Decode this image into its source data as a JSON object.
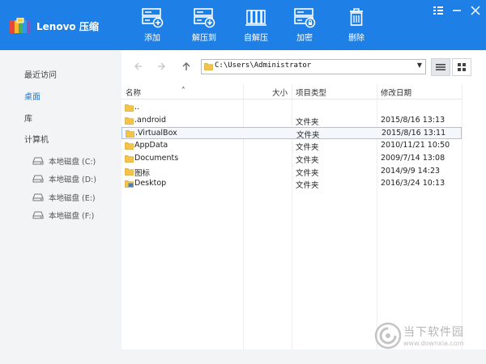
{
  "app": {
    "brand": "Lenovo 压缩"
  },
  "toolbar": [
    {
      "id": "add",
      "label": "添加"
    },
    {
      "id": "extract_to",
      "label": "解压到"
    },
    {
      "id": "self_extract",
      "label": "自解压"
    },
    {
      "id": "encrypt",
      "label": "加密"
    },
    {
      "id": "delete",
      "label": "删除"
    }
  ],
  "sidebar": {
    "items": [
      {
        "label": "最近访问",
        "active": false
      },
      {
        "label": "桌面",
        "active": true
      },
      {
        "label": "库",
        "active": false
      },
      {
        "label": "计算机",
        "active": false
      }
    ],
    "drives": [
      {
        "label": "本地磁盘 (C:)"
      },
      {
        "label": "本地磁盘 (D:)"
      },
      {
        "label": "本地磁盘 (E:)"
      },
      {
        "label": "本地磁盘 (F:)"
      }
    ]
  },
  "address": {
    "path": "C:\\Users\\Administrator"
  },
  "columns": {
    "name": "名称",
    "size": "大小",
    "type": "项目类型",
    "modified": "修改日期"
  },
  "files": [
    {
      "name": "..",
      "type": "",
      "modified": "",
      "selected": false,
      "icon": "folder-icon"
    },
    {
      "name": ".android",
      "type": "文件夹",
      "modified": "2015/8/16 13:13",
      "selected": false,
      "icon": "folder-icon"
    },
    {
      "name": ".VirtualBox",
      "type": "文件夹",
      "modified": "2015/8/16 13:11",
      "selected": true,
      "icon": "folder-icon"
    },
    {
      "name": "AppData",
      "type": "文件夹",
      "modified": "2010/11/21 10:50",
      "selected": false,
      "icon": "folder-icon"
    },
    {
      "name": "Documents",
      "type": "文件夹",
      "modified": "2009/7/14 13:08",
      "selected": false,
      "icon": "folder-icon"
    },
    {
      "name": "图标",
      "type": "文件夹",
      "modified": "2014/9/9 14:23",
      "selected": false,
      "icon": "folder-icon"
    },
    {
      "name": "Desktop",
      "type": "文件夹",
      "modified": "2016/3/24 10:13",
      "selected": false,
      "icon": "desktop-folder-icon"
    }
  ],
  "watermark": {
    "main": "当下软件园",
    "sub": "www.downxia.com"
  },
  "colors": {
    "accent": "#1e80e6",
    "sidebar": "#f3f4f6",
    "folder": "#f3c44a",
    "selection_border": "#a9c4e6"
  }
}
